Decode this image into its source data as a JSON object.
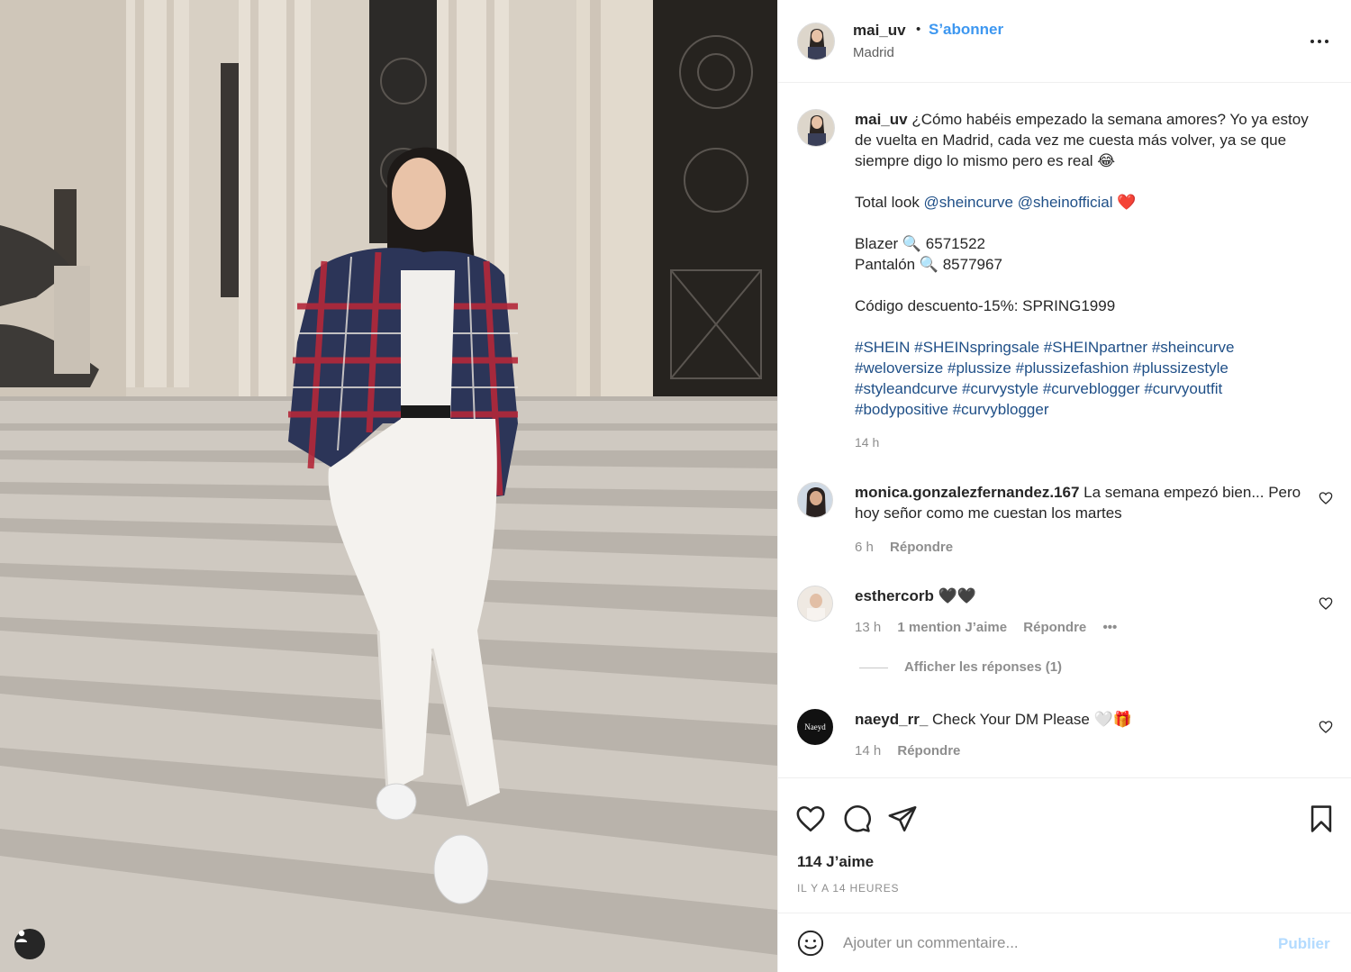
{
  "post": {
    "username": "mai_uv",
    "dot": "•",
    "follow_label": "S’abonner",
    "location": "Madrid"
  },
  "caption": {
    "username": "mai_uv",
    "line1": "¿Cómo habéis empezado la semana amores? Yo ya estoy de vuelta en Madrid, cada vez me cuesta más volver, ya se que siempre digo lo mismo pero es real 😂",
    "total_look_prefix": "Total look ",
    "mention1": "@sheincurve",
    "mention2": "@sheinofficial",
    "heart": "❤️",
    "blazer": "Blazer 🔍 6571522",
    "pantalon": "Pantalón 🔍 8577967",
    "code": "Código descuento-15%: SPRING1999",
    "hashtags": [
      "#SHEIN",
      "#SHEINspringsale",
      "#SHEINpartner",
      "#sheincurve",
      "#weloversize",
      "#plussize",
      "#plussizefashion",
      "#plussizestyle",
      "#styleandcurve",
      "#curvystyle",
      "#curveblogger",
      "#curvyoutfit",
      "#bodypositive",
      "#curvyblogger"
    ],
    "time": "14 h"
  },
  "comments": [
    {
      "username": "monica.gonzalezfernandez.167",
      "text": "La semana empezó bien... Pero hoy señor como me cuestan los martes",
      "time": "6 h",
      "reply": "Répondre"
    },
    {
      "username": "esthercorb",
      "text": "🖤🖤",
      "time": "13 h",
      "likes": "1 mention J’aime",
      "reply": "Répondre",
      "more": "•••",
      "view_replies": "Afficher les réponses (1)"
    },
    {
      "username": "naeyd_rr_",
      "avatar_text": "Naeyd",
      "text": "Check Your DM Please 🤍🎁",
      "time": "14 h",
      "reply": "Répondre"
    }
  ],
  "likes_label": "114 J’aime",
  "time_ago": "IL Y A 14 HEURES",
  "add_comment": {
    "placeholder": "Ajouter un commentaire...",
    "publish_label": "Publier"
  },
  "colors": {
    "follow_blue": "#3d97f0",
    "link_blue": "#1f4f87",
    "muted": "#8e8e8e",
    "publish_disabled": "#b3dbff"
  },
  "icons": [
    "more-options-icon",
    "heart-icon",
    "comment-icon",
    "share-icon",
    "bookmark-icon",
    "emoji-icon",
    "user-tag-icon"
  ]
}
